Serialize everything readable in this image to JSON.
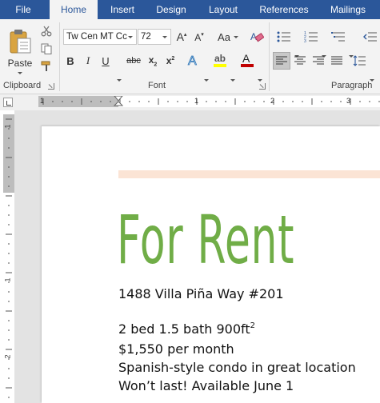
{
  "ribbon_tabs": [
    {
      "label": "File",
      "active": false
    },
    {
      "label": "Home",
      "active": true
    },
    {
      "label": "Insert",
      "active": false
    },
    {
      "label": "Design",
      "active": false
    },
    {
      "label": "Layout",
      "active": false
    },
    {
      "label": "References",
      "active": false
    },
    {
      "label": "Mailings",
      "active": false
    }
  ],
  "clipboard": {
    "group_label": "Clipboard",
    "paste_label": "Paste"
  },
  "font": {
    "group_label": "Font",
    "font_name": "Tw Cen MT Cc",
    "font_size": "72",
    "aa_label": "Aa"
  },
  "paragraph": {
    "group_label": "Paragraph"
  },
  "ruler": {
    "h_numbers": [
      "1",
      "1",
      "2",
      "3"
    ],
    "v_numbers": [
      "1",
      "1",
      "2"
    ]
  },
  "document": {
    "heading": "For Rent",
    "address": "1488 Villa Piña Way #201",
    "specs": "2 bed 1.5 bath 900ft",
    "specs_sup": "2",
    "price": "$1,550 per month",
    "description": "Spanish-style condo in great location",
    "availability": "Won’t last! Available June 1"
  },
  "colors": {
    "tab_bar": "#2b579a",
    "heading": "#70ad47",
    "accent_bar": "#fbe4d5",
    "highlight": "#ffff00",
    "font_color": "#c00000"
  }
}
